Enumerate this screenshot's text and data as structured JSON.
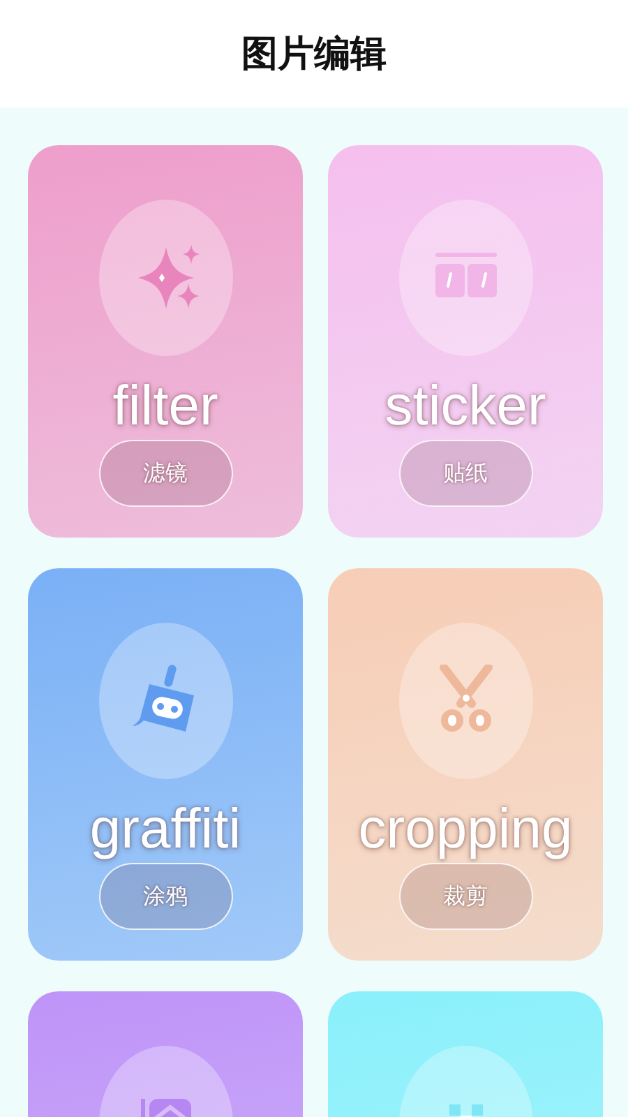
{
  "header": {
    "title": "图片编辑"
  },
  "cards": [
    {
      "kind": "filter",
      "color": "#ee9ecb",
      "watermark": "filter",
      "button": "滤镜"
    },
    {
      "kind": "sticker",
      "color": "#f5bfee",
      "watermark": "sticker",
      "button": "贴纸"
    },
    {
      "kind": "graffiti",
      "color": "#7ab0f6",
      "watermark": "graffiti",
      "button": "涂鸦"
    },
    {
      "kind": "cropping",
      "color": "#f7cdb5",
      "watermark": "cropping",
      "button": "裁剪"
    },
    {
      "kind": "frame",
      "color": "#bf93f8"
    },
    {
      "kind": "mosaic",
      "color": "#8af0fb"
    }
  ]
}
